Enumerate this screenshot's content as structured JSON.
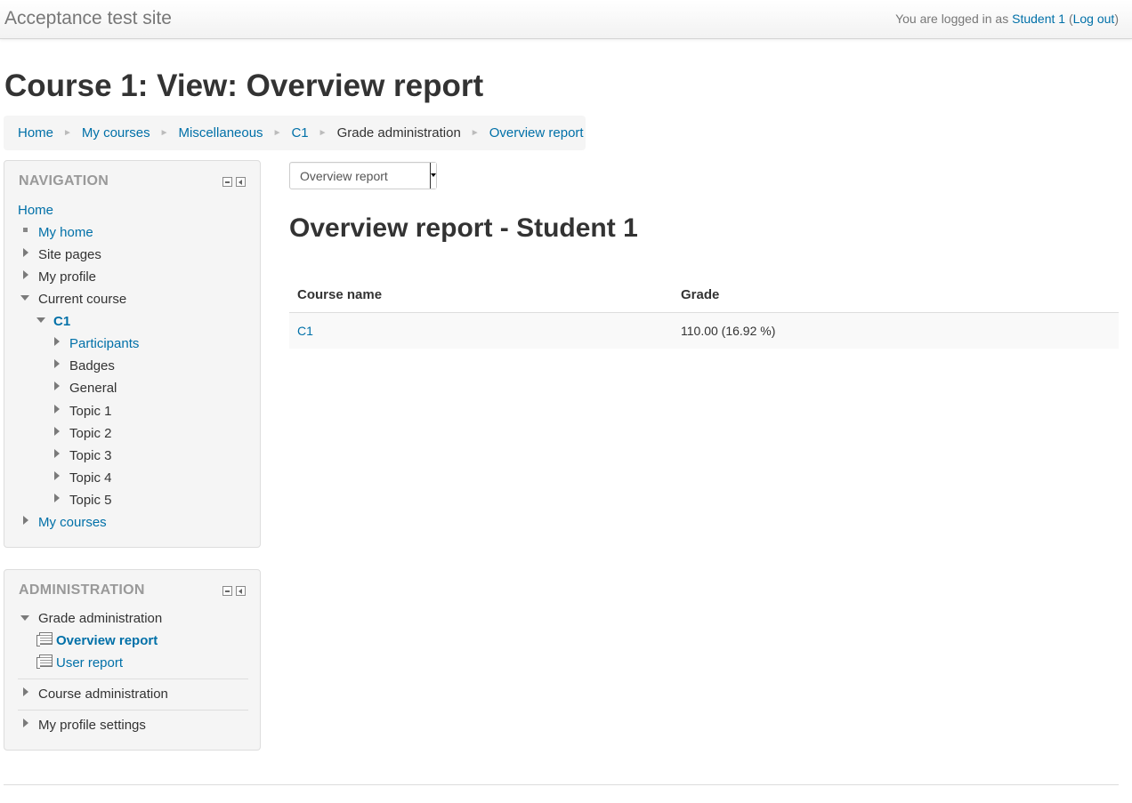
{
  "site": {
    "name": "Acceptance test site",
    "login_prefix": "You are logged in as",
    "user": "Student 1",
    "logout_open": "(",
    "logout": "Log out",
    "logout_close": ")"
  },
  "page_title": "Course 1: View: Overview report",
  "breadcrumb": [
    {
      "label": "Home",
      "link": true
    },
    {
      "label": "My courses",
      "link": true
    },
    {
      "label": "Miscellaneous",
      "link": true
    },
    {
      "label": "C1",
      "link": true
    },
    {
      "label": "Grade administration",
      "link": false
    },
    {
      "label": "Overview report",
      "link": true
    }
  ],
  "breadcrumb_separator": "►",
  "navigation": {
    "title": "NAVIGATION",
    "home": "Home",
    "my_home": "My home",
    "site_pages": "Site pages",
    "my_profile": "My profile",
    "current_course": "Current course",
    "course": "C1",
    "course_items": [
      "Participants",
      "Badges",
      "General",
      "Topic 1",
      "Topic 2",
      "Topic 3",
      "Topic 4",
      "Topic 5"
    ],
    "my_courses": "My courses"
  },
  "administration": {
    "title": "ADMINISTRATION",
    "grade_admin": "Grade administration",
    "overview_report": "Overview report",
    "user_report": "User report",
    "course_admin": "Course administration",
    "profile_settings": "My profile settings"
  },
  "report_selector": {
    "selected": "Overview report"
  },
  "report_heading": "Overview report - Student 1",
  "grade_table": {
    "headers": {
      "course": "Course name",
      "grade": "Grade"
    },
    "rows": [
      {
        "course": "C1",
        "grade": "110.00 (16.92 %)"
      }
    ]
  },
  "colors": {
    "link": "#0070a8",
    "text": "#333333",
    "block_title": "#999999"
  }
}
